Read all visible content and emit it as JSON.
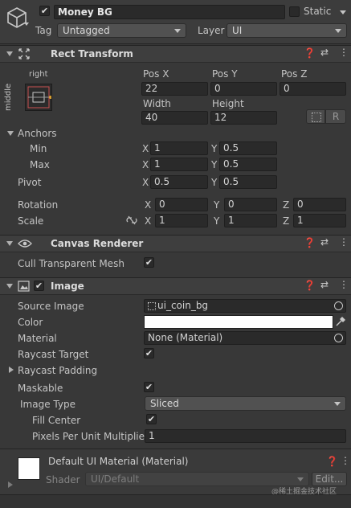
{
  "gameobject": {
    "name": "Money BG",
    "static_label": "Static",
    "active": true,
    "static": false,
    "tag_label": "Tag",
    "tag_value": "Untagged",
    "layer_label": "Layer",
    "layer_value": "UI"
  },
  "rect_transform": {
    "title": "Rect Transform",
    "anchor_h": "right",
    "anchor_v": "middle",
    "pos_x_label": "Pos X",
    "pos_y_label": "Pos Y",
    "pos_z_label": "Pos Z",
    "pos_x": "22",
    "pos_y": "0",
    "pos_z": "0",
    "width_label": "Width",
    "height_label": "Height",
    "width": "40",
    "height": "12",
    "raw_btn": "R",
    "anchors_label": "Anchors",
    "min_label": "Min",
    "max_label": "Max",
    "min_x": "1",
    "min_y": "0.5",
    "max_x": "1",
    "max_y": "0.5",
    "pivot_label": "Pivot",
    "pivot_x": "0.5",
    "pivot_y": "0.5",
    "rotation_label": "Rotation",
    "rot_x": "0",
    "rot_y": "0",
    "rot_z": "0",
    "scale_label": "Scale",
    "scale_x": "1",
    "scale_y": "1",
    "scale_z": "1",
    "x": "X",
    "y": "Y",
    "z": "Z"
  },
  "canvas_renderer": {
    "title": "Canvas Renderer",
    "cull_label": "Cull Transparent Mesh",
    "cull": true
  },
  "image": {
    "title": "Image",
    "enabled": true,
    "source_label": "Source Image",
    "source_value": "ui_coin_bg",
    "color_label": "Color",
    "color_value": "#ffffff",
    "material_label": "Material",
    "material_value": "None (Material)",
    "raycast_target_label": "Raycast Target",
    "raycast_target": true,
    "raycast_padding_label": "Raycast Padding",
    "maskable_label": "Maskable",
    "maskable": true,
    "image_type_label": "Image Type",
    "image_type_value": "Sliced",
    "fill_center_label": "Fill Center",
    "fill_center": true,
    "ppu_label": "Pixels Per Unit Multiplier",
    "ppu_value": "1"
  },
  "material_preview": {
    "title": "Default UI Material (Material)",
    "shader_label": "Shader",
    "shader_value": "UI/Default",
    "edit_btn": "Edit..."
  },
  "watermark": "@稀土掘金技术社区",
  "colors": {
    "background": "#383838",
    "header": "#3e3e3e",
    "field": "#2a2a2a",
    "text": "#c4c4c4"
  }
}
